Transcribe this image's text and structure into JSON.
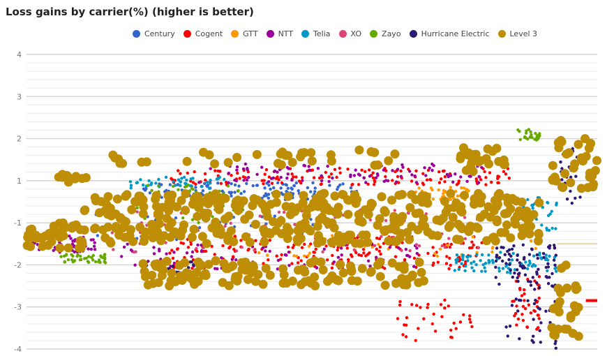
{
  "chart_data": {
    "type": "scatter",
    "title": "Loss gains by carrier(%) (higher is better)",
    "xlabel": "",
    "ylabel": "",
    "y_ticks": [
      "4",
      "3",
      "2",
      "1",
      "-1",
      "-2",
      "-3",
      "-4"
    ],
    "y_tick_positions": [
      4,
      3,
      2,
      1,
      0,
      -1,
      -2,
      -3
    ],
    "ylim": [
      -3,
      4
    ],
    "xlim": [
      0,
      100
    ],
    "minor_gridlines_per_major": 4,
    "grid": true,
    "legend": "top-center",
    "reference_line": {
      "series": "GTT",
      "y_display": -0.5,
      "x_from": 93,
      "x_to": 100
    },
    "series": [
      {
        "name": "Century",
        "color": "#3366cc",
        "marker": "small",
        "clusters": [
          {
            "x": [
              20,
              58
            ],
            "y": [
              0.55,
              0.95
            ],
            "n": 120
          },
          {
            "x": [
              10,
              60
            ],
            "y": [
              -0.4,
              0.2
            ],
            "n": 40
          }
        ]
      },
      {
        "name": "Cogent",
        "color": "#ff0000",
        "marker": "small",
        "clusters": [
          {
            "x": [
              25,
              85
            ],
            "y": [
              0.9,
              1.3
            ],
            "n": 140
          },
          {
            "x": [
              25,
              80
            ],
            "y": [
              -1.1,
              -0.3
            ],
            "n": 200
          },
          {
            "x": [
              65,
              79
            ],
            "y": [
              -2.8,
              -1.8
            ],
            "n": 35
          },
          {
            "x": [
              85,
              90
            ],
            "y": [
              -2.6,
              -1.2
            ],
            "n": 40
          }
        ],
        "segments": [
          {
            "x": [
              98,
              100
            ],
            "y": -1.85
          }
        ]
      },
      {
        "name": "GTT",
        "color": "#ff9900",
        "marker": "small",
        "clusters": [
          {
            "x": [
              68,
              78
            ],
            "y": [
              0.55,
              0.85
            ],
            "n": 40
          },
          {
            "x": [
              40,
              90
            ],
            "y": [
              -0.8,
              -0.3
            ],
            "n": 40
          }
        ]
      },
      {
        "name": "NTT",
        "color": "#990099",
        "marker": "small",
        "clusters": [
          {
            "x": [
              0,
              12
            ],
            "y": [
              -0.7,
              -0.3
            ],
            "n": 60
          },
          {
            "x": [
              30,
              80
            ],
            "y": [
              0.95,
              1.4
            ],
            "n": 90
          },
          {
            "x": [
              15,
              70
            ],
            "y": [
              -1.1,
              -0.5
            ],
            "n": 80
          }
        ]
      },
      {
        "name": "Telia",
        "color": "#0099c6",
        "marker": "small",
        "clusters": [
          {
            "x": [
              18,
              35
            ],
            "y": [
              0.8,
              1.1
            ],
            "n": 40
          },
          {
            "x": [
              75,
              93
            ],
            "y": [
              -1.2,
              -0.7
            ],
            "n": 80
          },
          {
            "x": [
              86,
              93
            ],
            "y": [
              -0.2,
              0.6
            ],
            "n": 40
          }
        ]
      },
      {
        "name": "XO",
        "color": "#dd4477",
        "marker": "small",
        "clusters": [
          {
            "x": [
              15,
              80
            ],
            "y": [
              -0.7,
              0.3
            ],
            "n": 90
          }
        ]
      },
      {
        "name": "Zayo",
        "color": "#66aa00",
        "marker": "small",
        "clusters": [
          {
            "x": [
              6,
              14
            ],
            "y": [
              -0.95,
              -0.75
            ],
            "n": 40
          },
          {
            "x": [
              18,
              38
            ],
            "y": [
              0.0,
              0.9
            ],
            "n": 50
          },
          {
            "x": [
              86,
              90
            ],
            "y": [
              1.95,
              2.25
            ],
            "n": 25
          }
        ]
      },
      {
        "name": "Hurricane Electric",
        "color": "#2c1873",
        "marker": "small",
        "clusters": [
          {
            "x": [
              20,
              30
            ],
            "y": [
              -1.2,
              -0.9
            ],
            "n": 25
          },
          {
            "x": [
              82,
              93
            ],
            "y": [
              -1.6,
              -0.5
            ],
            "n": 80
          },
          {
            "x": [
              84,
              93
            ],
            "y": [
              -3.0,
              -1.8
            ],
            "n": 30
          },
          {
            "x": [
              93,
              97
            ],
            "y": [
              0.4,
              1.8
            ],
            "n": 25
          }
        ]
      },
      {
        "name": "Level 3",
        "color": "#bd8e06",
        "marker": "large",
        "clusters": [
          {
            "x": [
              0,
              10
            ],
            "y": [
              -0.6,
              0.0
            ],
            "n": 40
          },
          {
            "x": [
              5,
              12
            ],
            "y": [
              0.95,
              1.15
            ],
            "n": 12
          },
          {
            "x": [
              10,
              90
            ],
            "y": [
              -0.5,
              0.7
            ],
            "n": 380
          },
          {
            "x": [
              20,
              70
            ],
            "y": [
              -1.5,
              -0.9
            ],
            "n": 120
          },
          {
            "x": [
              15,
              65
            ],
            "y": [
              1.35,
              1.75
            ],
            "n": 35
          },
          {
            "x": [
              76,
              84
            ],
            "y": [
              1.2,
              1.8
            ],
            "n": 25
          },
          {
            "x": [
              92,
              100
            ],
            "y": [
              0.8,
              2.0
            ],
            "n": 35
          },
          {
            "x": [
              92,
              97
            ],
            "y": [
              -2.9,
              -1.0
            ],
            "n": 25
          }
        ]
      }
    ]
  }
}
